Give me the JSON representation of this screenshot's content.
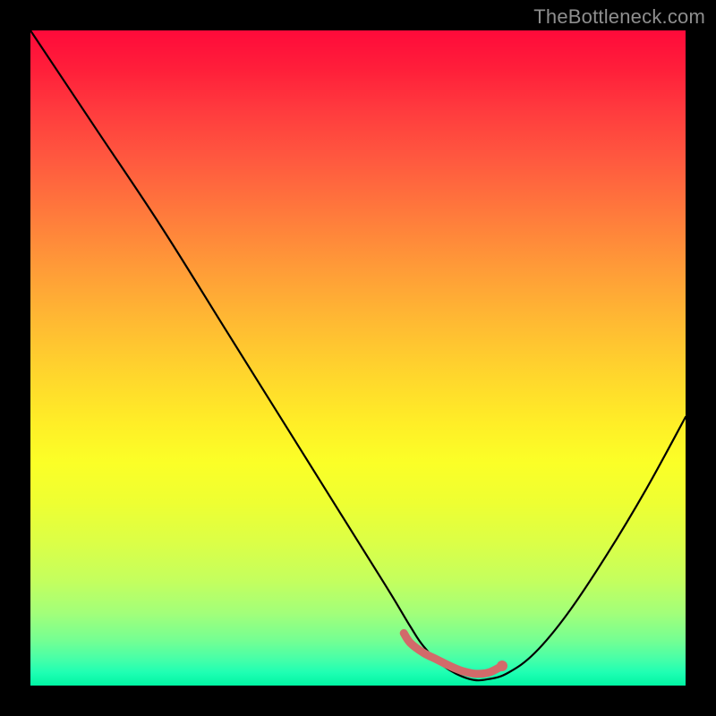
{
  "watermark": "TheBottleneck.com",
  "chart_data": {
    "type": "line",
    "title": "",
    "xlabel": "",
    "ylabel": "",
    "xlim": [
      0,
      100
    ],
    "ylim": [
      0,
      100
    ],
    "grid": false,
    "legend": false,
    "series": [
      {
        "name": "curve",
        "stroke": "#000000",
        "x": [
          0,
          10,
          20,
          30,
          40,
          50,
          55,
          58,
          60,
          63,
          67,
          70,
          73,
          77,
          82,
          88,
          94,
          100
        ],
        "y": [
          100,
          85,
          70,
          54,
          38,
          22,
          14,
          9,
          6,
          3,
          1,
          1,
          2,
          5,
          11,
          20,
          30,
          41
        ]
      },
      {
        "name": "highlight-band",
        "stroke": "#d26a6a",
        "x": [
          57,
          58,
          60,
          62,
          64,
          66,
          68,
          70,
          72
        ],
        "y": [
          8,
          6.5,
          5,
          4,
          3,
          2.2,
          1.8,
          2,
          3
        ]
      }
    ],
    "highlight_point": {
      "x": 72,
      "y": 3,
      "color": "#d26a6a"
    },
    "gradient_stops": [
      {
        "pos": 0.0,
        "color": "#ff0a3a"
      },
      {
        "pos": 0.5,
        "color": "#ffd42d"
      },
      {
        "pos": 0.8,
        "color": "#dcff46"
      },
      {
        "pos": 1.0,
        "color": "#00f5a3"
      }
    ]
  }
}
